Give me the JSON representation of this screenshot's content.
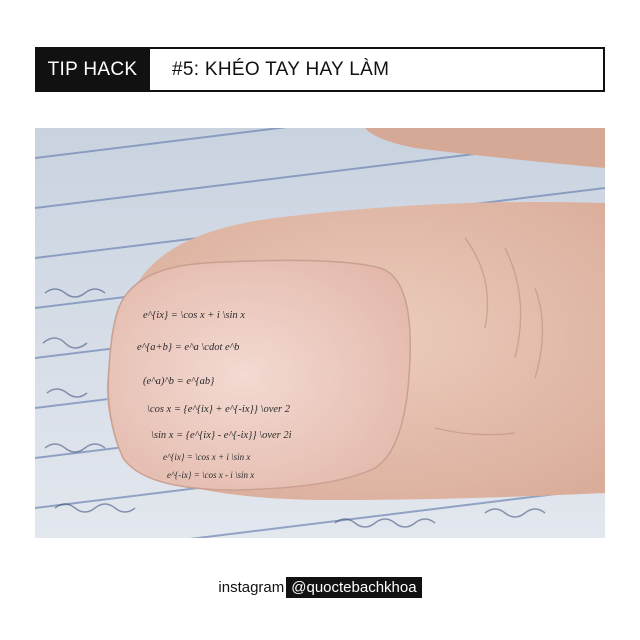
{
  "header": {
    "tag_label": "TIP HACK",
    "title": "#5: KHÉO TAY HAY LÀM"
  },
  "photo": {
    "subject": "thumb-with-formulas-written-on-nail",
    "nail_formulas": [
      "e^{ix} = \\cos x + i \\sin x",
      "e^{a+b} = e^a \\cdot e^b",
      "(e^a)^b = e^{ab}",
      "\\cos x = {e^{ix} + e^{-ix}} \\over 2",
      "\\sin x = {e^{ix} - e^{-ix}} \\over 2i",
      "e^{ix} = \\cos x + i \\sin x",
      "e^{-ix} = \\cos x - i \\sin x"
    ]
  },
  "footer": {
    "label": "instagram",
    "handle": "@quoctebachkhoa"
  },
  "colors": {
    "dark": "#111111",
    "paper": "#d9dfe8",
    "skin": "#e7c3b3",
    "nail": "#efcfc6"
  }
}
